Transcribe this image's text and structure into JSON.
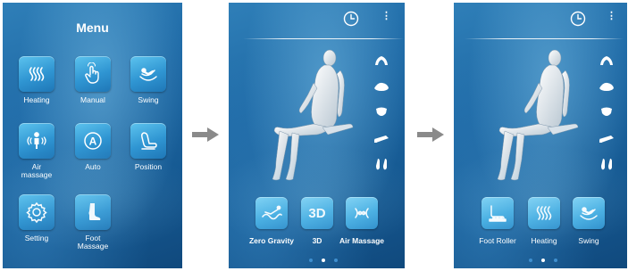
{
  "menu_screen": {
    "title": "Menu",
    "items": [
      {
        "label": "Heating",
        "icon": "heat-waves-icon"
      },
      {
        "label": "Manual",
        "icon": "hand-touch-icon"
      },
      {
        "label": "Swing",
        "icon": "swing-chair-icon"
      },
      {
        "label": "Air massage",
        "icon": "air-massage-icon"
      },
      {
        "label": "Auto",
        "icon": "auto-a-icon"
      },
      {
        "label": "Position",
        "icon": "position-chair-icon"
      },
      {
        "label": "Setting",
        "icon": "gear-icon"
      },
      {
        "label": "Foot Massage",
        "icon": "foot-icon"
      }
    ]
  },
  "screen_a": {
    "buttons": [
      {
        "label": "Zero Gravity",
        "icon": "zero-gravity-icon",
        "style": "bold"
      },
      {
        "label": "3D",
        "tile_text": "3D",
        "style": "bold"
      },
      {
        "label": "Air Massage",
        "icon": "air-massage-waves-icon",
        "style": "bold"
      }
    ],
    "pager": {
      "count": 3,
      "active": 1
    }
  },
  "screen_b": {
    "buttons": [
      {
        "label": "Foot Roller",
        "icon": "foot-roller-icon"
      },
      {
        "label": "Heating",
        "icon": "heat-waves-icon"
      },
      {
        "label": "Swing",
        "icon": "swing-chair-icon"
      }
    ],
    "pager": {
      "count": 3,
      "active": 1
    }
  },
  "side_icons": [
    "shoulder-icon",
    "back-icon",
    "waist-icon",
    "seat-icon",
    "feet-icon"
  ],
  "colors": {
    "screen_bg": "#1f6aa6",
    "tile": "#2f95d2",
    "arrow": "#8a8a8a",
    "pager_active": "#ffffff",
    "pager_inactive": "#3f8fcf"
  }
}
